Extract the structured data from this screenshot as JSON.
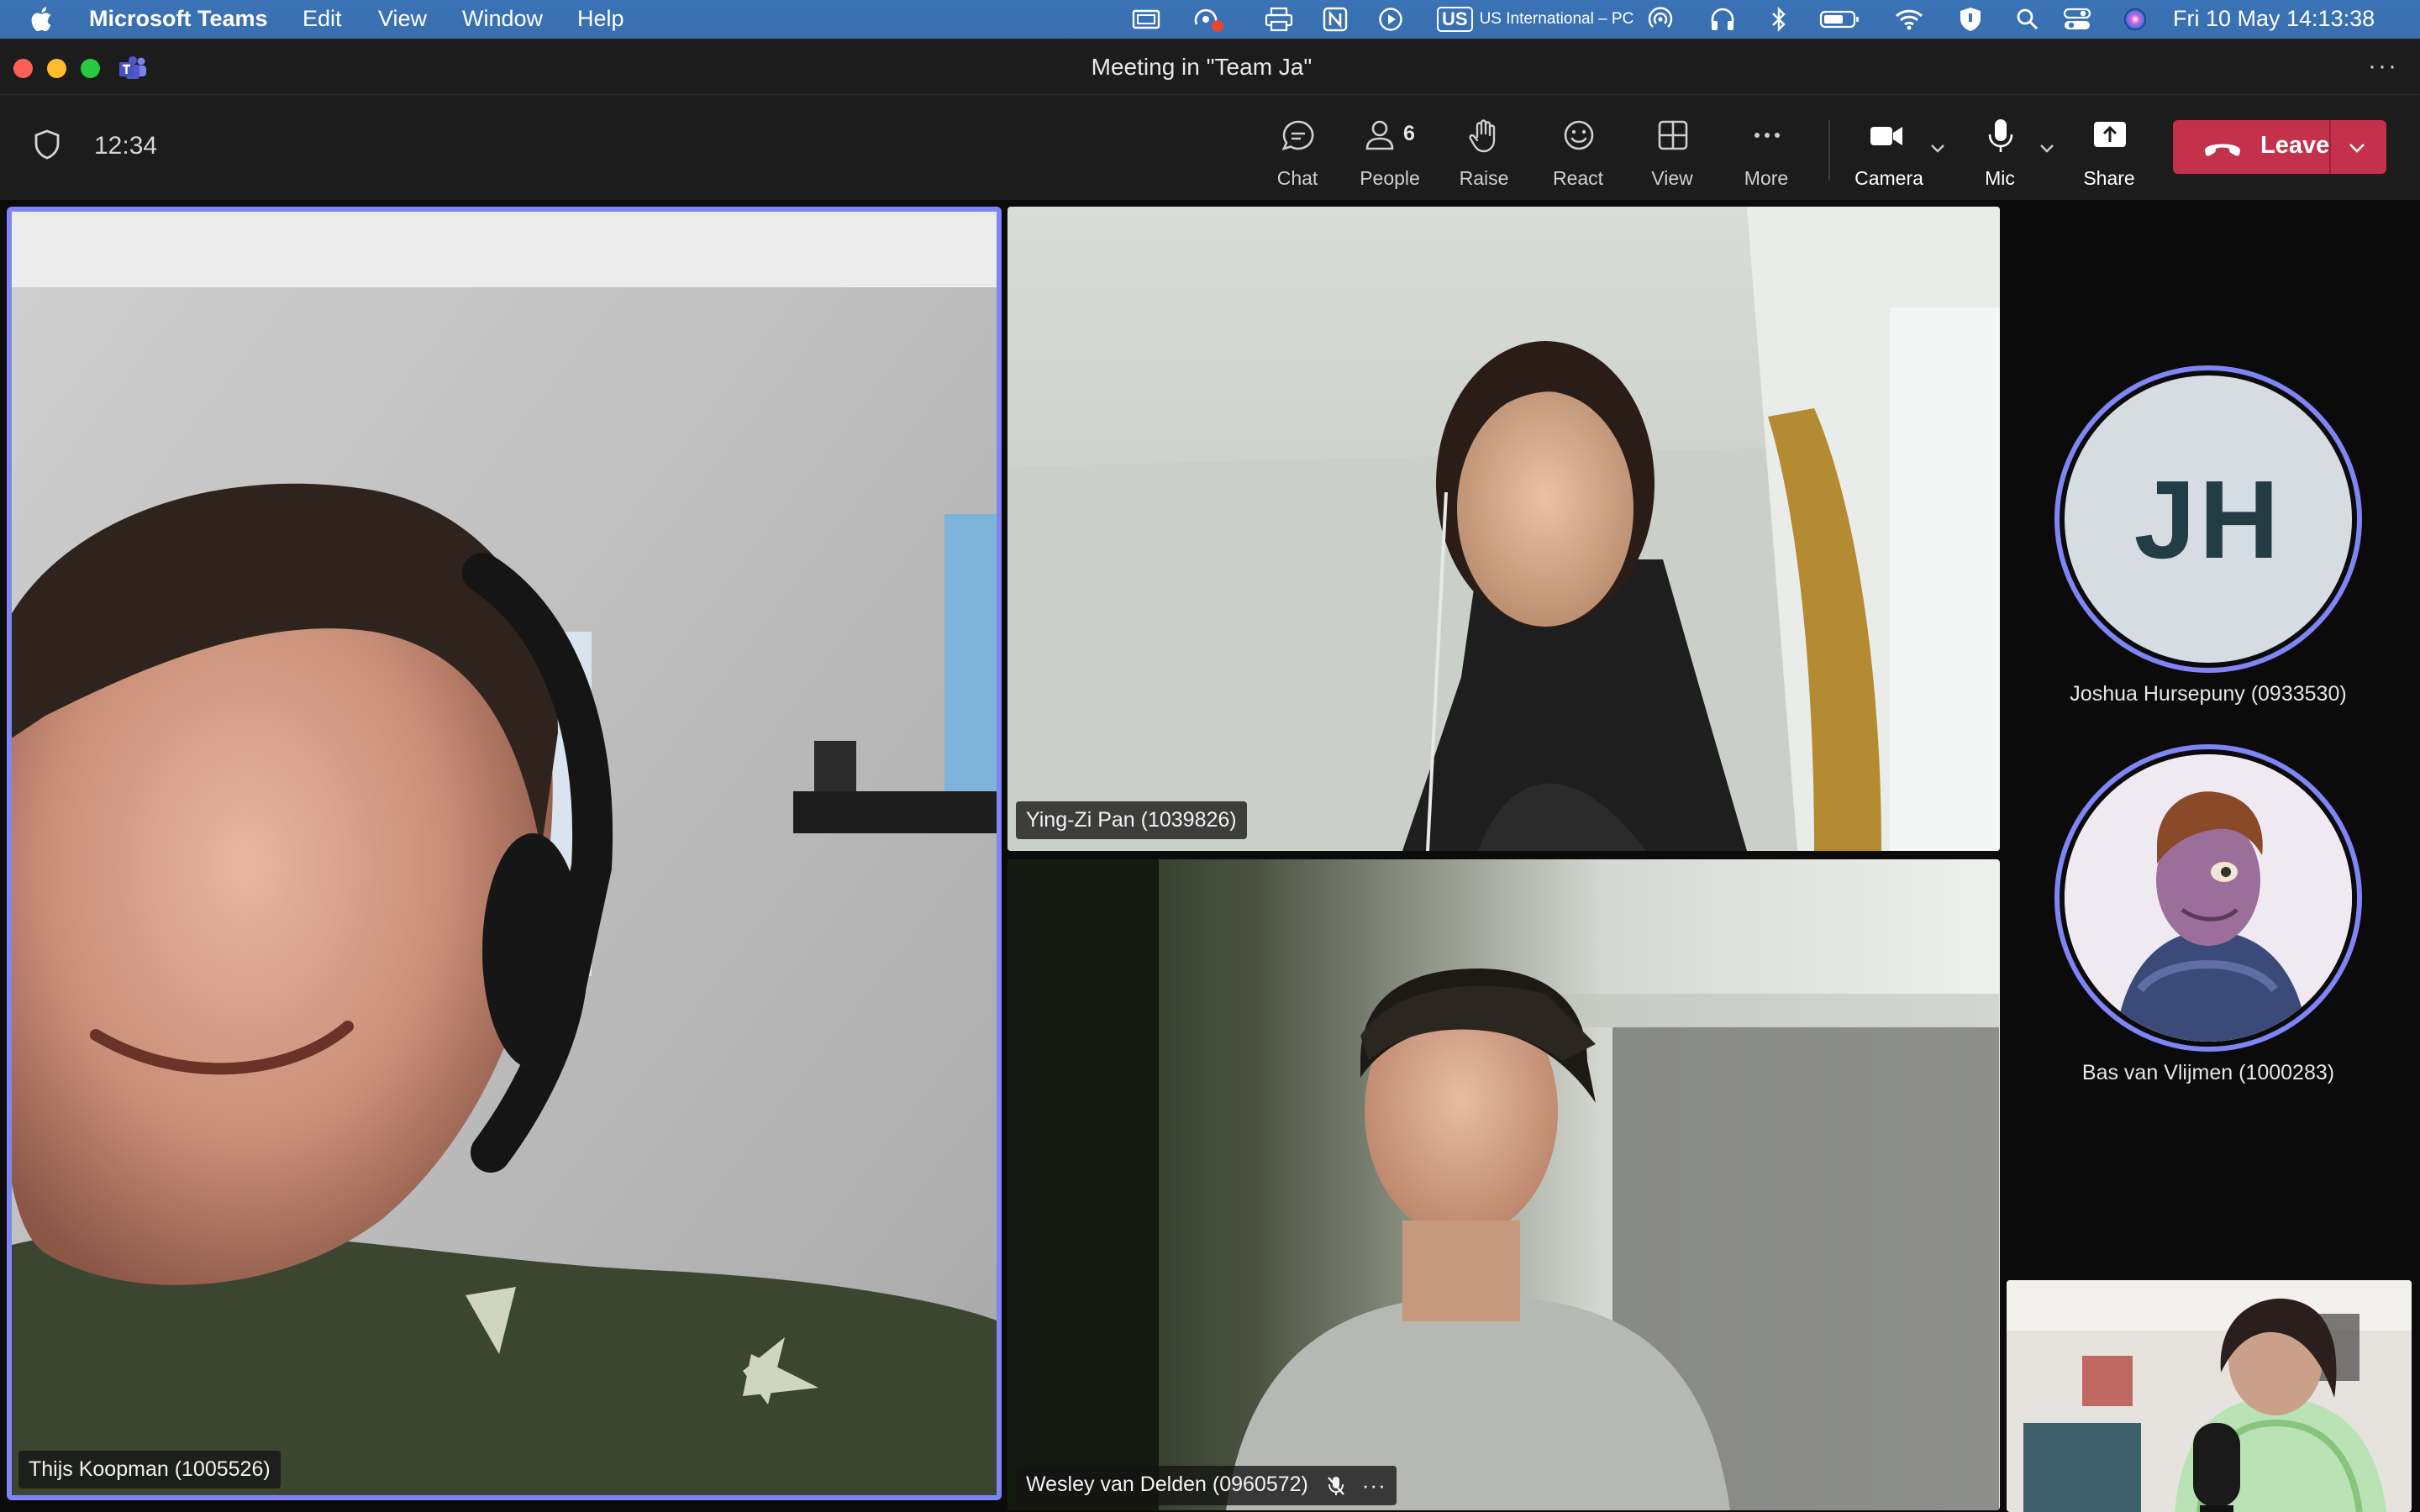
{
  "menubar": {
    "app_name": "Microsoft Teams",
    "menus": [
      "Edit",
      "View",
      "Window",
      "Help"
    ],
    "keyboard_code": "US",
    "keyboard_layout": "US International – PC",
    "datetime": "Fri 10 May  14:13:38",
    "icons": [
      "display-mirror-icon",
      "screen-record-icon",
      "printer-icon",
      "notion-icon",
      "play-icon",
      "airdrop-icon",
      "headphones-icon",
      "bluetooth-icon",
      "battery-icon",
      "wifi-icon",
      "vpn-shield-icon",
      "spotlight-search-icon",
      "control-center-icon",
      "siri-icon"
    ]
  },
  "window": {
    "title": "Meeting in \"Team Ja\"",
    "more": "···"
  },
  "toolbar": {
    "timer": "12:34",
    "chat_label": "Chat",
    "people_label": "People",
    "people_count": "6",
    "raise_label": "Raise",
    "react_label": "React",
    "view_label": "View",
    "more_label": "More",
    "camera_label": "Camera",
    "mic_label": "Mic",
    "share_label": "Share",
    "leave_label": "Leave",
    "leave_color": "#c4314b"
  },
  "participants": {
    "main_speaker": "Thijs Koopman (1005526)",
    "top_right": "Ying-Zi Pan (1039826)",
    "bottom_right": "Wesley van Delden (0960572)",
    "avatar1_name": "Joshua Hursepuny (0933530)",
    "avatar1_initials": "JH",
    "avatar2_name": "Bas van Vlijmen (1000283)"
  },
  "colors": {
    "accent": "#7f85f5",
    "menubar": "#3a73b6",
    "toolbar": "#1c1c1c"
  }
}
